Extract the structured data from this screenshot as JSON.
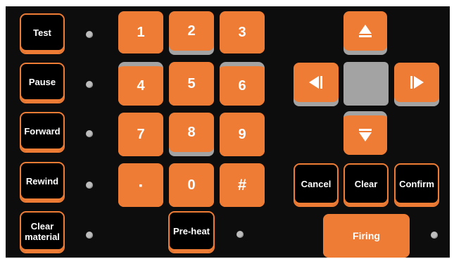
{
  "side_keys": {
    "test": "Test",
    "pause": "Pause",
    "forward": "Forward",
    "rewind": "Rewind",
    "clear_material_line1": "Clear",
    "clear_material_line2": "material"
  },
  "keypad": {
    "k1": "1",
    "k2": "2",
    "k3": "3",
    "k4": "4",
    "k5": "5",
    "k6": "6",
    "k7": "7",
    "k8": "8",
    "k9": "9",
    "dot": "▪",
    "k0": "0",
    "hash": "#"
  },
  "bottom_keys": {
    "preheat": "Pre-heat",
    "cancel": "Cancel",
    "clear": "Clear",
    "confirm": "Confirm",
    "firing": "Firing"
  },
  "icons": {
    "up": "arrow-up-icon",
    "down": "arrow-down-icon",
    "left": "arrow-left-icon",
    "right": "arrow-right-icon"
  },
  "colors": {
    "panel": "#0d0d0d",
    "accent": "#ee7c34",
    "key_shadow": "#a3a3a3",
    "indicator": "#bdbdbd"
  }
}
